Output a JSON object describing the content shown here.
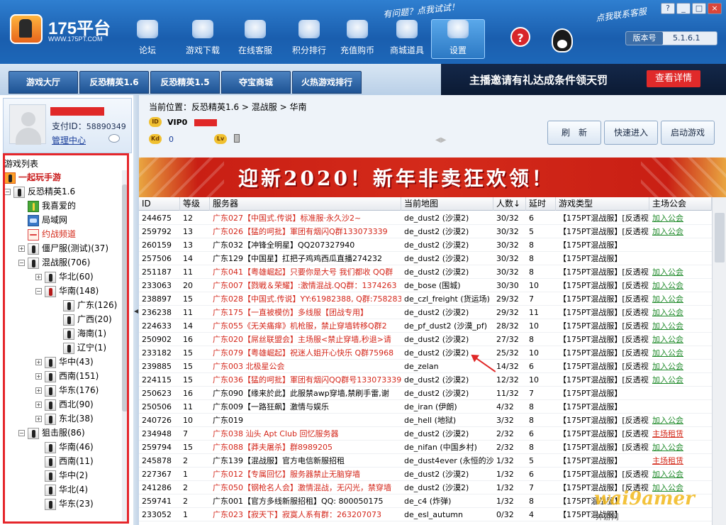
{
  "window": {
    "title": "175平台",
    "url": "WWW.175PT.COM",
    "controls": [
      "?",
      "_",
      "□",
      "×"
    ]
  },
  "header": {
    "nav": [
      {
        "label": "论坛",
        "icon": "forum-icon"
      },
      {
        "label": "游戏下载",
        "icon": "download-icon"
      },
      {
        "label": "在线客服",
        "icon": "support-icon"
      },
      {
        "label": "积分排行",
        "icon": "star-icon"
      },
      {
        "label": "充值购币",
        "icon": "coins-icon"
      },
      {
        "label": "商城道具",
        "icon": "cart-icon"
      },
      {
        "label": "设置",
        "icon": "gear-icon",
        "active": true
      }
    ],
    "hint_help": "有问题？点我试试！",
    "hint_service": "点我联系客服",
    "version_label": "版本号",
    "version_value": "5.1.6.1"
  },
  "tabs": [
    "游戏大厅",
    "反恐精英1.6",
    "反恐精英1.5",
    "夺宝商城",
    "火热游戏排行"
  ],
  "top_banner": {
    "text": "主播邀请有礼达成条件领天罚",
    "button": "查看详情"
  },
  "profile": {
    "pay_id_label": "支付ID：",
    "pay_id": "58890349",
    "manage": "管理中心"
  },
  "game_list_title": "游戏列表",
  "tree": [
    {
      "label": "一起玩手游",
      "level": 0,
      "style": "bold-red",
      "icon": "hand"
    },
    {
      "label": "反恐精英1.6",
      "level": 0,
      "exp": "−",
      "icon": "cs"
    },
    {
      "label": "我喜爱的",
      "level": 1,
      "icon": "gift"
    },
    {
      "label": "局域网",
      "level": 1,
      "icon": "lan"
    },
    {
      "label": "约战频道",
      "level": 1,
      "icon": "yue",
      "style": "red-t"
    },
    {
      "label": "僵尸服(测试)(37)",
      "level": 1,
      "exp": "+",
      "icon": "cs"
    },
    {
      "label": "混战服(706)",
      "level": 1,
      "exp": "−",
      "icon": "cs"
    },
    {
      "label": "华北(60)",
      "level": 2,
      "exp": "+",
      "icon": "cs"
    },
    {
      "label": "华南(148)",
      "level": 2,
      "exp": "−",
      "icon": "csred"
    },
    {
      "label": "广东(126)",
      "level": 3,
      "icon": "cs"
    },
    {
      "label": "广西(20)",
      "level": 3,
      "icon": "cs"
    },
    {
      "label": "海南(1)",
      "level": 3,
      "icon": "cs"
    },
    {
      "label": "辽宁(1)",
      "level": 3,
      "icon": "cs"
    },
    {
      "label": "华中(43)",
      "level": 2,
      "exp": "+",
      "icon": "cs"
    },
    {
      "label": "西南(151)",
      "level": 2,
      "exp": "+",
      "icon": "cs"
    },
    {
      "label": "华东(176)",
      "level": 2,
      "exp": "+",
      "icon": "cs"
    },
    {
      "label": "西北(90)",
      "level": 2,
      "exp": "+",
      "icon": "cs"
    },
    {
      "label": "东北(38)",
      "level": 2,
      "exp": "+",
      "icon": "cs"
    },
    {
      "label": "狙击服(86)",
      "level": 1,
      "exp": "−",
      "icon": "cs"
    },
    {
      "label": "华南(46)",
      "level": 2,
      "icon": "cs"
    },
    {
      "label": "西南(11)",
      "level": 2,
      "icon": "cs"
    },
    {
      "label": "华中(2)",
      "level": 2,
      "icon": "cs"
    },
    {
      "label": "华北(4)",
      "level": 2,
      "icon": "cs"
    },
    {
      "label": "华东(23)",
      "level": 2,
      "icon": "cs"
    }
  ],
  "main": {
    "breadcrumb": "当前位置：反恐精英1.6 > 混战服 > 华南",
    "vip": "VIP0",
    "kd": "0",
    "buttons": {
      "refresh": "刷　新",
      "quick": "快速进入",
      "launch": "启动游戏"
    },
    "promo": "迎新2020！新年非卖狂欢领！"
  },
  "table": {
    "headers": [
      "ID",
      "等级",
      "服务器",
      "当前地图",
      "人数↓",
      "延时",
      "游戏类型",
      "主场公会"
    ],
    "rows": [
      [
        "244675",
        "12",
        "广东027【中国式.传说】标准服·永久沙2~",
        "de_dust2 (沙漠2)",
        "30/32",
        "6",
        "【175PT混战服】[反透视]",
        "加入公会",
        true
      ],
      [
        "259792",
        "13",
        "广东026【猛的呵批】軍团有烟闪Q群133073339",
        "de_dust2 (沙漠2)",
        "30/32",
        "5",
        "【175PT混战服】[反透视]",
        "加入公会",
        true
      ],
      [
        "260159",
        "13",
        "广东032【冲锋全明星】QQ207327940",
        "de_dust2 (沙漠2)",
        "30/32",
        "8",
        "【175PT混战服】",
        "",
        false
      ],
      [
        "257506",
        "14",
        "广东129【中国星】扛把子鸡鸡西瓜直播274232",
        "de_dust2 (沙漠2)",
        "30/32",
        "8",
        "【175PT混战服】",
        "",
        false
      ],
      [
        "251187",
        "11",
        "广东041【粤雄崛起】只要你是大号 我们都收 QQ群",
        "de_dust2 (沙漠2)",
        "30/32",
        "8",
        "【175PT混战服】[反透视]",
        "加入公会",
        true
      ],
      [
        "233063",
        "20",
        "广东007【戮戦＆荣耀】:激情混战.QQ群：1374263",
        "de_bose (围城)",
        "30/30",
        "10",
        "【175PT混战服】[反透视]",
        "加入公会",
        true
      ],
      [
        "238897",
        "15",
        "广东028【中国式.传说】YY:61982388, Q群:758283",
        "de_czl_freight (货运场)",
        "29/32",
        "7",
        "【175PT混战服】[反透视]",
        "加入公会",
        true
      ],
      [
        "236238",
        "11",
        "广东175【一直被模仿】多线服【团战专用】",
        "de_dust2 (沙漠2)",
        "29/32",
        "11",
        "【175PT混战服】[反透视]",
        "加入公会",
        true
      ],
      [
        "224633",
        "14",
        "广东055《无关痛痒》机枪服，禁止穿墙转移Q群2",
        "de_pf_dust2 (沙漠_pf)",
        "28/32",
        "10",
        "【175PT混战服】[反透视]",
        "加入公会",
        true
      ],
      [
        "250902",
        "16",
        "广东020【屌丝联盟会】主场服<禁止穿墙,秒退>请",
        "de_dust2 (沙漠2)",
        "27/32",
        "8",
        "【175PT混战服】[反透视]",
        "加入公会",
        true
      ],
      [
        "233182",
        "15",
        "广东079【粤雄崛起】祝迷人姐开心快乐 Q群75968",
        "de_dust2 (沙漠2)",
        "25/32",
        "10",
        "【175PT混战服】[反透视]",
        "加入公会",
        true
      ],
      [
        "239885",
        "15",
        "广东003 北极星公会",
        "de_zelan",
        "14/32",
        "6",
        "【175PT混战服】[反透视]",
        "加入公会",
        true
      ],
      [
        "224115",
        "15",
        "广东036【猛的呵批】軍团有烟闪QQ群号133073339",
        "de_dust2 (沙漠2)",
        "12/32",
        "10",
        "【175PT混战服】[反透视]",
        "加入公会",
        true
      ],
      [
        "250623",
        "16",
        "广东090【缘来於此】此服禁awp穿墙,禁刷手雷,谢",
        "de_dust2 (沙漠2)",
        "11/32",
        "7",
        "【175PT混战服】",
        "",
        false
      ],
      [
        "250506",
        "11",
        "广东009【一路狂飙】激情与娱乐",
        "de_iran (伊朗)",
        "4/32",
        "8",
        "【175PT混战服】",
        "",
        false
      ],
      [
        "240726",
        "10",
        "广东019",
        "de_hell (地狱)",
        "3/32",
        "8",
        "【175PT混战服】[反透视]",
        "加入公会",
        false
      ],
      [
        "234948",
        "7",
        "广东038 汕头 Apt Club 回忆服务器",
        "de_dust2 (沙漠2)",
        "2/32",
        "6",
        "【175PT混战服】[反透视]",
        "主场租赁",
        true
      ],
      [
        "259794",
        "15",
        "广东088【莽夫屠杀】群8989205",
        "de_nifan (中国乡村)",
        "2/32",
        "8",
        "【175PT混战服】[反透视]",
        "加入公会",
        true
      ],
      [
        "245878",
        "2",
        "广东139【混战服】官方电信新服招租",
        "de_dust4ever (永恒的沙漠)",
        "1/32",
        "5",
        "【175PT混战服】",
        "主场租赁",
        false
      ],
      [
        "227367",
        "1",
        "广东012【专属回忆】服务器禁止无脑穿墙",
        "de_dust2 (沙漠2)",
        "1/32",
        "6",
        "【175PT混战服】[反透视]",
        "加入公会",
        true
      ],
      [
        "241286",
        "2",
        "广东050【钢枪名人会】激情混战，无闪光，禁穿墙",
        "de_dust2 (沙漠2)",
        "1/32",
        "7",
        "【175PT混战服】[反透视]",
        "加入公会",
        true
      ],
      [
        "259741",
        "2",
        "广东001【官方多线新服招租】QQ: 800050175",
        "de_c4 (炸弹)",
        "1/32",
        "8",
        "【175PT混战服】",
        "",
        false
      ],
      [
        "233052",
        "1",
        "广东023【寂天下】寂寞人系有群：263207073",
        "de_esl_autumn",
        "0/32",
        "4",
        "【175PT混战服】",
        "",
        true
      ]
    ]
  },
  "watermark": {
    "main": "wai9amer",
    "sub": "外游网"
  }
}
